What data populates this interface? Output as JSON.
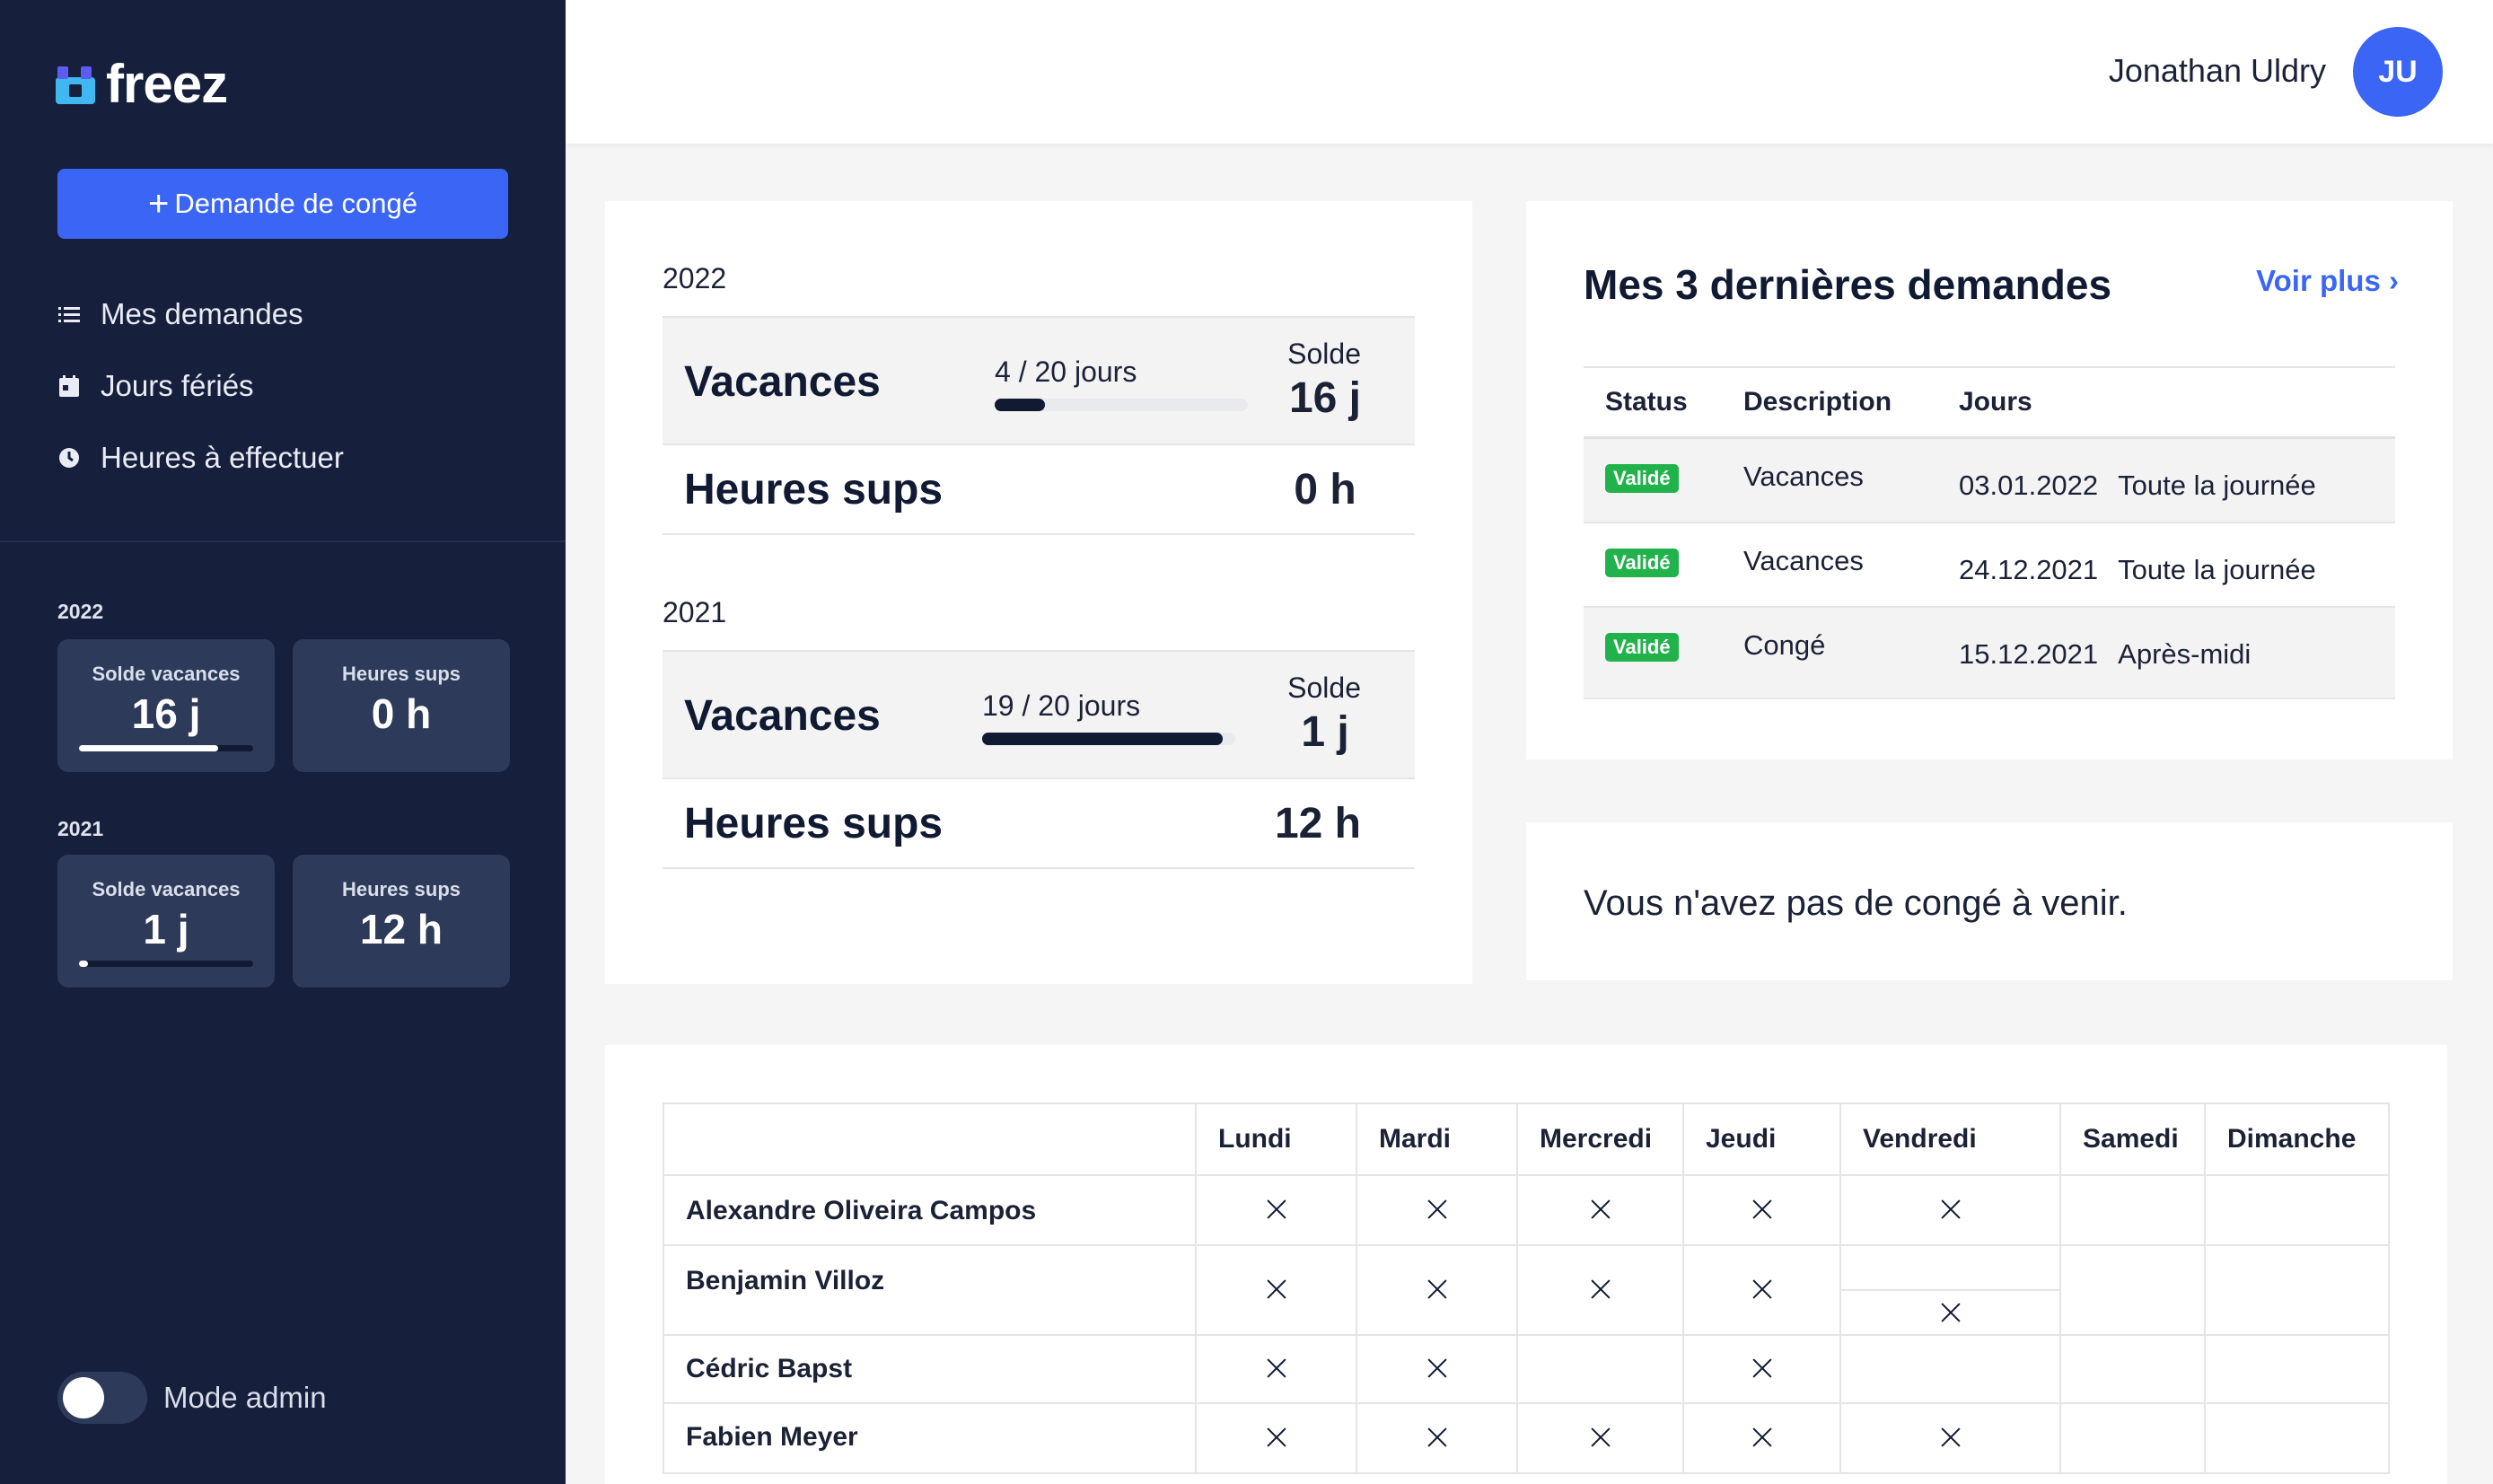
{
  "app": {
    "name": "freez"
  },
  "sidebar": {
    "new_request_label": "Demande de congé",
    "nav": [
      {
        "label": "Mes demandes",
        "icon": "list-icon"
      },
      {
        "label": "Jours fériés",
        "icon": "calendar-icon"
      },
      {
        "label": "Heures à effectuer",
        "icon": "clock-icon"
      }
    ],
    "years": [
      {
        "year": "2022",
        "solde_label": "Solde vacances",
        "solde_value": "16 j",
        "solde_fraction": 0.8,
        "hs_label": "Heures sups",
        "hs_value": "0 h"
      },
      {
        "year": "2021",
        "solde_label": "Solde vacances",
        "solde_value": "1 j",
        "solde_fraction": 0.05,
        "hs_label": "Heures sups",
        "hs_value": "12 h"
      }
    ],
    "admin_label": "Mode admin",
    "admin_enabled": false
  },
  "header": {
    "user_name": "Jonathan Uldry",
    "initials": "JU"
  },
  "balances": [
    {
      "year": "2022",
      "vac_title": "Vacances",
      "days": "4 / 20 jours",
      "used_fraction": 0.2,
      "solde_label": "Solde",
      "solde_value": "16 j",
      "hs_title": "Heures sups",
      "hs_value": "0 h"
    },
    {
      "year": "2021",
      "vac_title": "Vacances",
      "days": "19 / 20 jours",
      "used_fraction": 0.95,
      "solde_label": "Solde",
      "solde_value": "1 j",
      "hs_title": "Heures sups",
      "hs_value": "12 h"
    }
  ],
  "requests": {
    "title": "Mes 3 dernières demandes",
    "more_label": "Voir plus",
    "headers": {
      "status": "Status",
      "description": "Description",
      "jours": "Jours"
    },
    "rows": [
      {
        "status": "Validé",
        "description": "Vacances",
        "date": "03.01.2022",
        "period": "Toute la journée"
      },
      {
        "status": "Validé",
        "description": "Vacances",
        "date": "24.12.2021",
        "period": "Toute la journée"
      },
      {
        "status": "Validé",
        "description": "Congé",
        "date": "15.12.2021",
        "period": "Après-midi"
      }
    ]
  },
  "upcoming": {
    "message": "Vous n'avez pas de congé à venir."
  },
  "week": {
    "days": [
      "Lundi",
      "Mardi",
      "Mercredi",
      "Jeudi",
      "Vendredi",
      "Samedi",
      "Dimanche"
    ],
    "people": [
      {
        "name": "Alexandre Oliveira Campos"
      },
      {
        "name": "Benjamin Villoz"
      },
      {
        "name": "Cédric Bapst"
      },
      {
        "name": "Fabien Meyer"
      }
    ]
  },
  "colors": {
    "sidebar": "#161f3c",
    "primary": "#3b66f5",
    "success": "#22b24c"
  }
}
